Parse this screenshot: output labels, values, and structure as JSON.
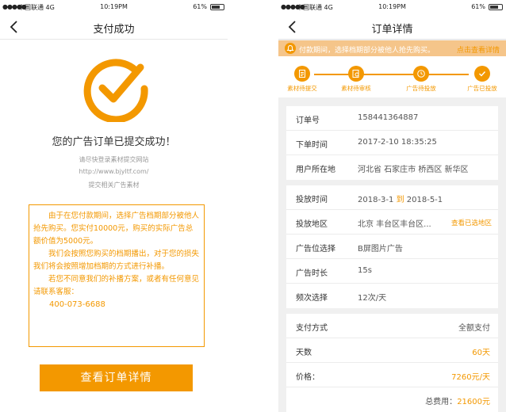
{
  "status_bar": {
    "carrier": "中国联通 4G",
    "time": "10:19PM",
    "battery": "61%"
  },
  "left": {
    "title": "支付成功",
    "success_text": "您的广告订单已提交成功！",
    "hints": [
      "请尽快登录素材提交网站",
      "http://www.bjyltf.com/",
      "提交相关广告素材"
    ],
    "notice": [
      "由于在您付款期间，选择广告档期部分被他人抢先购买。您实付10000元，购买的实际广告总额价值为5000元。",
      "我们会按照您购买的档期播出，对于您的损失我们将会按照增加档期的方式进行补播。",
      "若您不同意我们的补播方案，或者有任何意见请联系客服："
    ],
    "phone": "400-073-6688",
    "view_button": "查看订单详情"
  },
  "right": {
    "title": "订单详情",
    "banner": {
      "message": "付款期间，选择档期部分被他人抢先购买。",
      "link": "点击查看详情"
    },
    "steps": [
      {
        "label": "素材待提交"
      },
      {
        "label": "素材待审核"
      },
      {
        "label": "广告待投放"
      },
      {
        "label": "广告已投放"
      }
    ],
    "order": {
      "order_no_label": "订单号",
      "order_no": "158441364887",
      "time_label": "下单时间",
      "time": "2017-2-10  18:35:25",
      "location_label": "用户所在地",
      "location": "河北省 石家庄市 桥西区 新华区"
    },
    "ad": {
      "period_label": "投放时间",
      "period_start": "2018-3-1",
      "period_sep": "到",
      "period_end": "2018-5-1",
      "area_label": "投放地区",
      "area": "北京 丰台区丰台区...",
      "area_link": "查看已选地区",
      "position_label": "广告位选择",
      "position": "B屏图片广告",
      "duration_label": "广告时长",
      "duration": "15s",
      "frequency_label": "频次选择",
      "frequency": "12次/天"
    },
    "payment": {
      "method_label": "支付方式",
      "method": "全额支付",
      "days_label": "天数",
      "days": "60天",
      "price_label": "价格：",
      "price": "7260元/天",
      "total_label": "总费用：",
      "total": "21600元"
    }
  },
  "colors": {
    "accent": "#f39800",
    "banner_bg": "#f5c58a",
    "page_bg": "#f0f0f0"
  }
}
